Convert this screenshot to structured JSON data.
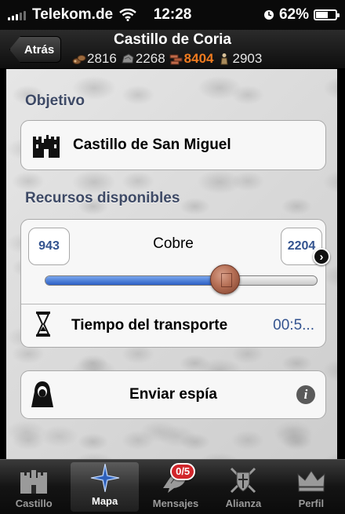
{
  "status_bar": {
    "carrier": "Telekom.de",
    "time": "12:28",
    "battery_percent": "62%",
    "battery_level": 0.62
  },
  "nav": {
    "back_label": "Atrás",
    "title": "Castillo de Coria",
    "resources": [
      {
        "icon": "wood-icon",
        "value": "2816"
      },
      {
        "icon": "stone-icon",
        "value": "2268"
      },
      {
        "icon": "ore-icon",
        "value": "8404",
        "highlight": true
      },
      {
        "icon": "population-icon",
        "value": "2903"
      }
    ]
  },
  "objective": {
    "header": "Objetivo",
    "target": "Castillo de San Miguel"
  },
  "resources_section": {
    "header": "Recursos disponibles",
    "min_value": "943",
    "resource_name": "Cobre",
    "max_value": "2204",
    "slider_fraction": 0.66,
    "transport_label": "Tiempo del transporte",
    "transport_value": "00:5..."
  },
  "spy": {
    "label": "Enviar espía"
  },
  "tabs": [
    {
      "label": "Castillo",
      "icon": "castle-tab-icon",
      "selected": false
    },
    {
      "label": "Mapa",
      "icon": "compass-icon",
      "selected": true
    },
    {
      "label": "Mensajes",
      "icon": "raven-icon",
      "selected": false,
      "badge": "0/5"
    },
    {
      "label": "Alianza",
      "icon": "shield-swords-icon",
      "selected": false
    },
    {
      "label": "Perfil",
      "icon": "crown-icon",
      "selected": false
    }
  ],
  "colors": {
    "accent_blue": "#33538f",
    "highlight_orange": "#f07b1f",
    "badge_red": "#d1262b"
  }
}
